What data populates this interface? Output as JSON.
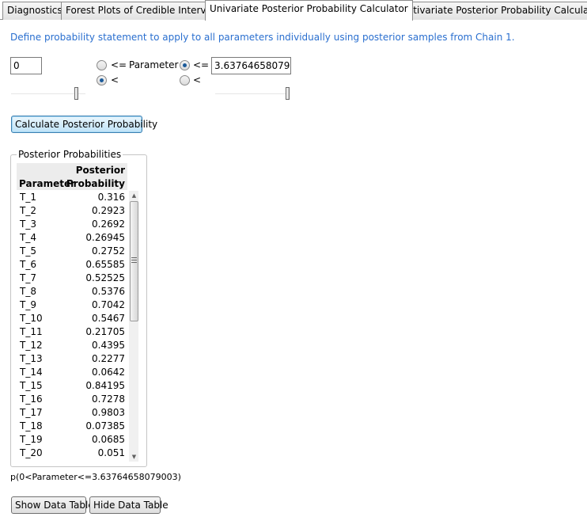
{
  "tabs": [
    {
      "label": "Diagnostics"
    },
    {
      "label": "Forest Plots of Credible Intervals"
    },
    {
      "label": "Univariate Posterior Probability Calculator"
    },
    {
      "label": "Multivariate Posterior Probability Calculator"
    }
  ],
  "intro_text": "Define probability statement to apply to all parameters individually using posterior samples from Chain 1.",
  "controls": {
    "lower_value": "0",
    "lower_options": [
      "<=",
      "<"
    ],
    "lower_selected": "<",
    "parameter_label": "Parameter",
    "upper_options": [
      "<=",
      "<"
    ],
    "upper_selected": "<=",
    "upper_value": "3.63764658079003",
    "lower_slider_level": 0.9,
    "upper_slider_level": 1.0
  },
  "calculate_label": "Calculate Posterior Probability",
  "results": {
    "group_title": "Posterior Probabilities",
    "header_col2_line1": "Posterior",
    "header_col1": "Parameter",
    "header_col2_line2": "Probability",
    "rows": [
      {
        "param": "T_1",
        "prob": "0.316"
      },
      {
        "param": "T_2",
        "prob": "0.2923"
      },
      {
        "param": "T_3",
        "prob": "0.2692"
      },
      {
        "param": "T_4",
        "prob": "0.26945"
      },
      {
        "param": "T_5",
        "prob": "0.2752"
      },
      {
        "param": "T_6",
        "prob": "0.65585"
      },
      {
        "param": "T_7",
        "prob": "0.52525"
      },
      {
        "param": "T_8",
        "prob": "0.5376"
      },
      {
        "param": "T_9",
        "prob": "0.7042"
      },
      {
        "param": "T_10",
        "prob": "0.5467"
      },
      {
        "param": "T_11",
        "prob": "0.21705"
      },
      {
        "param": "T_12",
        "prob": "0.4395"
      },
      {
        "param": "T_13",
        "prob": "0.2277"
      },
      {
        "param": "T_14",
        "prob": "0.0642"
      },
      {
        "param": "T_15",
        "prob": "0.84195"
      },
      {
        "param": "T_16",
        "prob": "0.7278"
      },
      {
        "param": "T_17",
        "prob": "0.9803"
      },
      {
        "param": "T_18",
        "prob": "0.07385"
      },
      {
        "param": "T_19",
        "prob": "0.0685"
      },
      {
        "param": "T_20",
        "prob": "0.051"
      }
    ]
  },
  "statement": "p(0<Parameter<=3.63764658079003)",
  "buttons": {
    "show": "Show Data Table",
    "hide": "Hide Data Table"
  },
  "colors": {
    "intro_text": "#2a6fcf",
    "radio_selected": "#1c5b9a"
  }
}
